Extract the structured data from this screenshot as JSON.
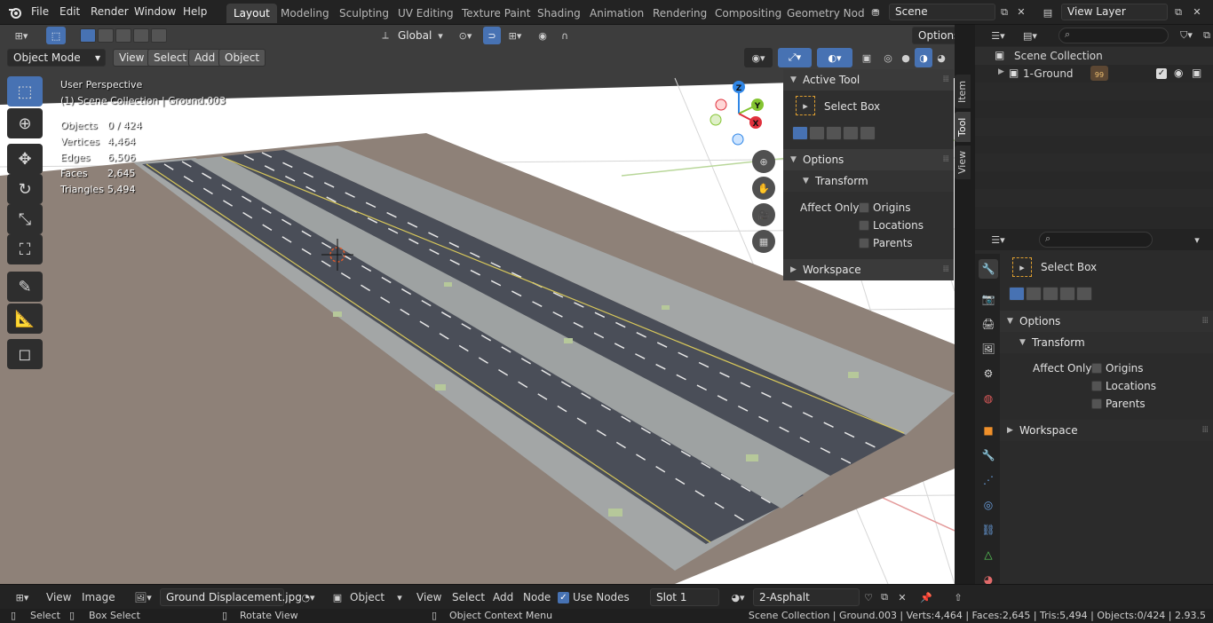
{
  "topbar": {
    "menus": [
      "File",
      "Edit",
      "Render",
      "Window",
      "Help"
    ],
    "workspaces": [
      "Layout",
      "Modeling",
      "Sculpting",
      "UV Editing",
      "Texture Paint",
      "Shading",
      "Animation",
      "Rendering",
      "Compositing",
      "Geometry Nod"
    ],
    "active_workspace": "Layout",
    "scene": "Scene",
    "view_layer": "View Layer"
  },
  "viewport": {
    "mode": "Object Mode",
    "menus": [
      "View",
      "Select",
      "Add",
      "Object"
    ],
    "orientation": "Global",
    "options_label": "Options",
    "perspective": "User Perspective",
    "context": "(1) Scene Collection | Ground.003",
    "stats": [
      {
        "label": "Objects",
        "value": "0 / 424"
      },
      {
        "label": "Vertices",
        "value": "4,464"
      },
      {
        "label": "Edges",
        "value": "6,506"
      },
      {
        "label": "Faces",
        "value": "2,645"
      },
      {
        "label": "Triangles",
        "value": "5,494"
      }
    ],
    "gizmo_axes": {
      "x": "X",
      "y": "Y",
      "z": "Z"
    },
    "colors": {
      "x_axis": "#e0303c",
      "y_axis": "#84c431",
      "z_axis": "#2f86e6"
    }
  },
  "npanel": {
    "active_tool_header": "Active Tool",
    "tool_name": "Select Box",
    "options_header": "Options",
    "transform_header": "Transform",
    "affect_only": "Affect Only",
    "checks": [
      "Origins",
      "Locations",
      "Parents"
    ],
    "workspace_header": "Workspace",
    "tabs": [
      "Item",
      "Tool",
      "View"
    ],
    "active_tab": "Tool"
  },
  "outliner": {
    "root": "Scene Collection",
    "items": [
      {
        "name": "1-Ground",
        "badge": "99"
      }
    ]
  },
  "properties": {
    "tool_name": "Select Box",
    "options_header": "Options",
    "transform_header": "Transform",
    "affect_only": "Affect Only",
    "checks": [
      "Origins",
      "Locations",
      "Parents"
    ],
    "workspace_header": "Workspace"
  },
  "bottombar": {
    "view": "View",
    "image": "Image",
    "image_name": "Ground Displacement.jpg",
    "object_mode": "Object",
    "view2": "View",
    "select": "Select",
    "add": "Add",
    "node": "Node",
    "use_nodes": "Use Nodes",
    "slot": "Slot 1",
    "material": "2-Asphalt"
  },
  "statusbar": {
    "select": "Select",
    "box_select": "Box Select",
    "rotate_view": "Rotate View",
    "context_menu": "Object Context Menu",
    "info": "Scene Collection | Ground.003 | Verts:4,464 | Faces:2,645 | Tris:5,494 | Objects:0/424 | 2.93.5"
  }
}
